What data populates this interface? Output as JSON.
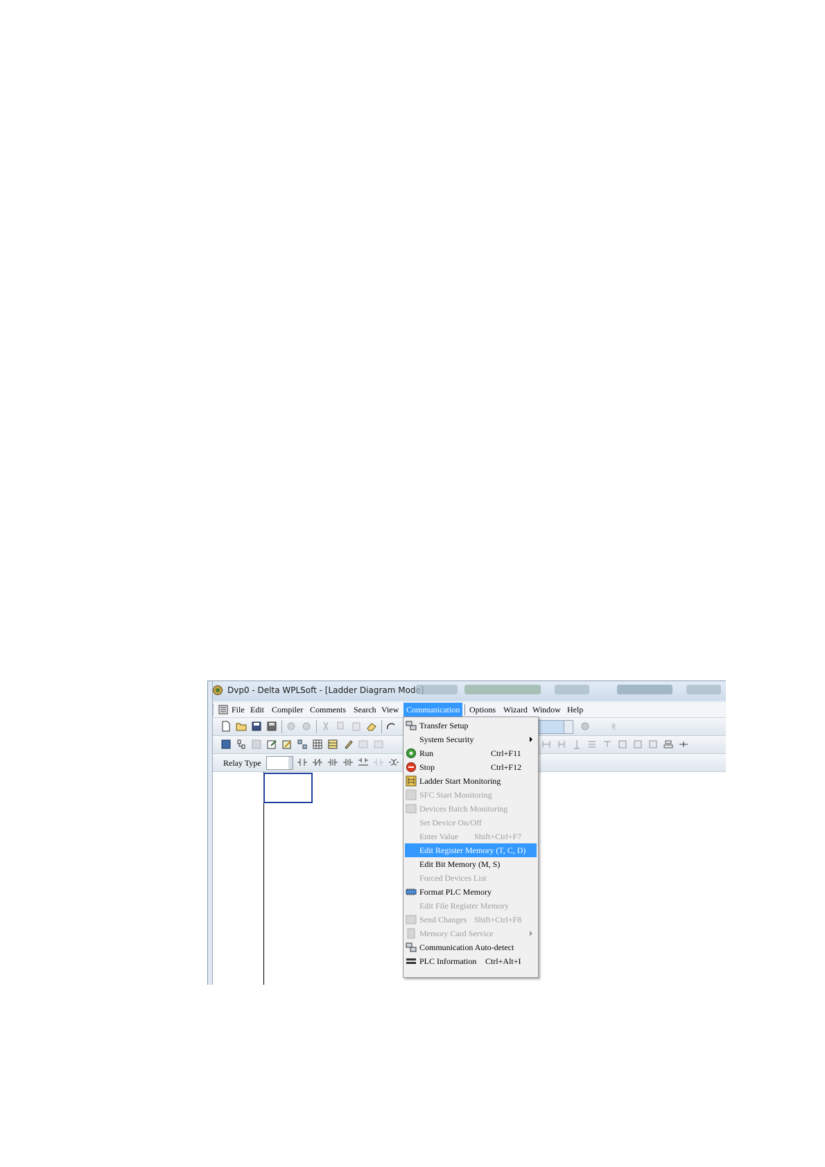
{
  "window": {
    "title": "Dvp0 - Delta WPLSoft - [Ladder Diagram Mode]"
  },
  "menubar": {
    "items": [
      {
        "label": "File",
        "underline": "F"
      },
      {
        "label": "Edit",
        "underline": "E"
      },
      {
        "label": "Compiler",
        "underline": "p"
      },
      {
        "label": "Comments",
        "underline": "m"
      },
      {
        "label": "Search",
        "underline": "S"
      },
      {
        "label": "View",
        "underline": "V"
      },
      {
        "label": "Communication",
        "underline": "C",
        "active": true
      },
      {
        "label": "Options",
        "underline": "O"
      },
      {
        "label": "Wizard",
        "underline": "z"
      },
      {
        "label": "Window",
        "underline": "W"
      },
      {
        "label": "Help",
        "underline": "H"
      }
    ]
  },
  "toolbar3": {
    "relay_label": "Relay Type"
  },
  "colors": {
    "highlight": "#3399ff",
    "disabled": "#9d9d9d",
    "menu_bg": "#f0f0f0"
  },
  "comm_menu": {
    "items": [
      {
        "label": "Transfer Setup",
        "icon": "transfer-setup-icon",
        "enabled": true
      },
      {
        "label": "System Security",
        "enabled": true,
        "submenu": true
      },
      {
        "label": "Run",
        "shortcut": "Ctrl+F11",
        "icon": "run-icon",
        "enabled": true
      },
      {
        "label": "Stop",
        "shortcut": "Ctrl+F12",
        "icon": "stop-icon",
        "enabled": true
      },
      {
        "label": "Ladder Start Monitoring",
        "icon": "ladder-monitor-icon",
        "enabled": true
      },
      {
        "label": "SFC Start Monitoring",
        "icon": "sfc-monitor-icon",
        "enabled": false
      },
      {
        "label": "Devices Batch Monitoring",
        "icon": "batch-monitor-icon",
        "enabled": false
      },
      {
        "label": "Set Device On/Off",
        "enabled": false
      },
      {
        "label": "Enter Value",
        "shortcut": "Shift+Ctrl+F7",
        "enabled": false
      },
      {
        "label": "Edit Register Memory (T, C, D)",
        "enabled": true,
        "highlighted": true
      },
      {
        "label": "Edit Bit Memory (M, S)",
        "enabled": true
      },
      {
        "label": "Forced Devices List",
        "enabled": false
      },
      {
        "label": "Format PLC Memory",
        "icon": "format-memory-icon",
        "enabled": true
      },
      {
        "label": "Edit File Register Memory",
        "enabled": false
      },
      {
        "label": "Send Changes",
        "shortcut": "Shift+Ctrl+F8",
        "icon": "send-changes-icon",
        "enabled": false
      },
      {
        "label": "Memory Card Service",
        "icon": "memory-card-icon",
        "enabled": false,
        "submenu": true
      },
      {
        "label": "Communication Auto-detect",
        "icon": "auto-detect-icon",
        "enabled": true
      },
      {
        "label": "PLC Information",
        "shortcut": "Ctrl+Alt+I",
        "icon": "plc-info-icon",
        "enabled": true
      }
    ]
  }
}
